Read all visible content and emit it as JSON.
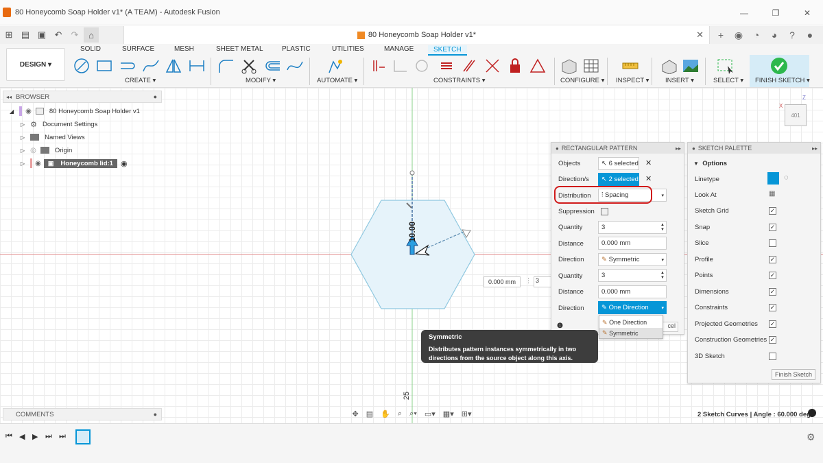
{
  "window": {
    "title": "80 Honeycomb Soap Holder v1* (A TEAM) - Autodesk Fusion",
    "min": "—",
    "max": "❐",
    "close": "✕"
  },
  "doc_tab": {
    "title": "80 Honeycomb Soap Holder v1*"
  },
  "ribbon": {
    "workspace": "DESIGN",
    "tabs": [
      "SOLID",
      "SURFACE",
      "MESH",
      "SHEET METAL",
      "PLASTIC",
      "UTILITIES",
      "MANAGE",
      "SKETCH"
    ],
    "groups": [
      "CREATE",
      "MODIFY",
      "AUTOMATE",
      "CONSTRAINTS",
      "CONFIGURE",
      "INSPECT",
      "INSERT",
      "SELECT",
      "FINISH SKETCH"
    ]
  },
  "browser": {
    "header": "BROWSER",
    "items": [
      "80 Honeycomb Soap Holder v1",
      "Document Settings",
      "Named Views",
      "Origin",
      "Honeycomb lid:1"
    ]
  },
  "comments": {
    "header": "COMMENTS"
  },
  "canvas": {
    "dimension_vertical": "10.00",
    "axis_label_bottom": "25",
    "float_distance": "0.000 mm",
    "float_qty": "3",
    "viewcube": "401",
    "viewcube_x": "X",
    "viewcube_z": "Z"
  },
  "pattern_panel": {
    "title": "RECTANGULAR PATTERN",
    "objects_label": "Objects",
    "objects_value": "6 selected",
    "directions_label": "Direction/s",
    "directions_value": "2 selected",
    "distribution_label": "Distribution",
    "distribution_value": "Spacing",
    "suppression_label": "Suppression",
    "quantity_label": "Quantity",
    "quantity1": "3",
    "distance_label": "Distance",
    "distance1": "0.000 mm",
    "direction_label": "Direction",
    "direction1": "Symmetric",
    "quantity2": "3",
    "distance2": "0.000 mm",
    "direction2": "One Direction",
    "dropdown_options": [
      "One Direction",
      "Symmetric"
    ],
    "cancel_label": "cel"
  },
  "tooltip": {
    "title": "Symmetric",
    "body": "Distributes pattern instances symmetrically in two directions from the source object along this axis."
  },
  "sketch_palette": {
    "title": "SKETCH PALETTE",
    "section": "Options",
    "rows": [
      {
        "label": "Linetype",
        "checked": null
      },
      {
        "label": "Look At",
        "checked": null
      },
      {
        "label": "Sketch Grid",
        "checked": true
      },
      {
        "label": "Snap",
        "checked": true
      },
      {
        "label": "Slice",
        "checked": false
      },
      {
        "label": "Profile",
        "checked": true
      },
      {
        "label": "Points",
        "checked": true
      },
      {
        "label": "Dimensions",
        "checked": true
      },
      {
        "label": "Constraints",
        "checked": true
      },
      {
        "label": "Projected Geometries",
        "checked": true
      },
      {
        "label": "Construction Geometries",
        "checked": true
      },
      {
        "label": "3D Sketch",
        "checked": false
      }
    ],
    "finish_label": "Finish Sketch"
  },
  "status": {
    "text": "2 Sketch Curves | Angle : 60.000 deg"
  },
  "colors": {
    "accent": "#0696d7",
    "highlight": "#d01a1a",
    "hexagon": "#9fd0e6",
    "finish_green": "#2db84d"
  }
}
